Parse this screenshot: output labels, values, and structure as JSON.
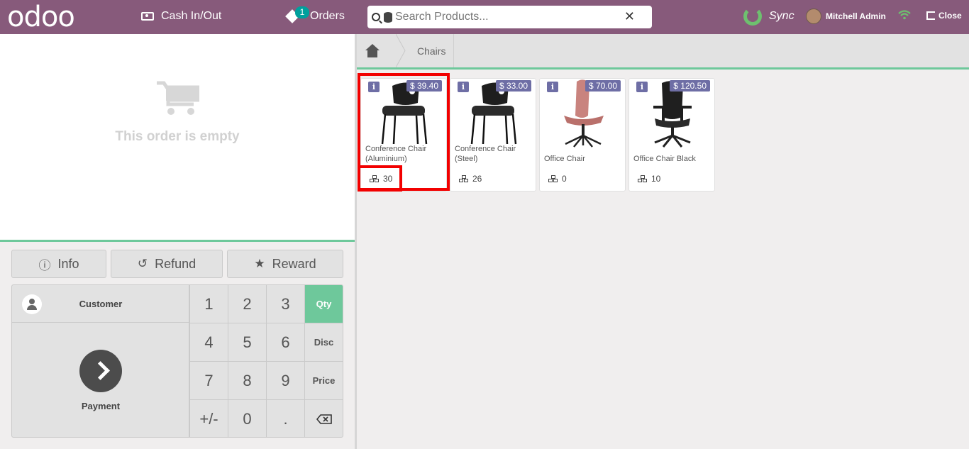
{
  "header": {
    "logo": "odoo",
    "cash_label": "Cash In/Out",
    "orders_label": "Orders",
    "orders_count": "1",
    "search_placeholder": "Search Products...",
    "sync_label": "Sync",
    "user_name": "Mitchell Admin",
    "close_label": "Close"
  },
  "order": {
    "empty_text": "This order is empty"
  },
  "actions": {
    "info": "Info",
    "refund": "Refund",
    "reward": "Reward"
  },
  "pad": {
    "customer": "Customer",
    "payment": "Payment",
    "keys": [
      "1",
      "2",
      "3",
      "4",
      "5",
      "6",
      "7",
      "8",
      "9",
      "+/-",
      "0",
      "."
    ],
    "modes": [
      "Qty",
      "Disc",
      "Price"
    ],
    "active_mode": "Qty"
  },
  "breadcrumb": {
    "category": "Chairs"
  },
  "products": [
    {
      "name": "Conference Chair (Aluminium)",
      "price": "$ 39.40",
      "stock": "30"
    },
    {
      "name": "Conference Chair (Steel)",
      "price": "$ 33.00",
      "stock": "26"
    },
    {
      "name": "Office Chair",
      "price": "$ 70.00",
      "stock": "0"
    },
    {
      "name": "Office Chair Black",
      "price": "$ 120.50",
      "stock": "10"
    }
  ],
  "colors": {
    "header_bg": "#875a7b",
    "accent_green": "#6ec89b",
    "price_tag": "#6e6ea5",
    "highlight": "#f20000"
  }
}
